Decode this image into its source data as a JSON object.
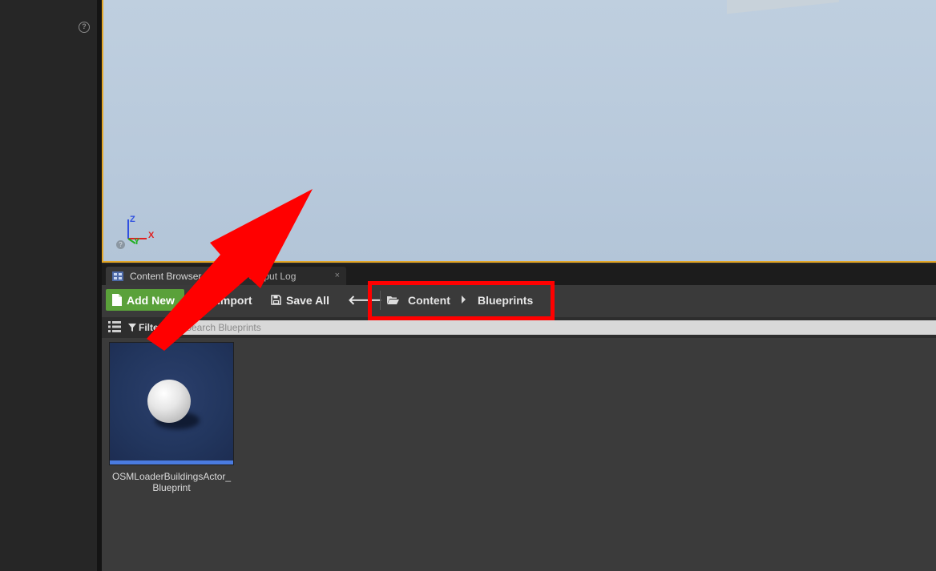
{
  "tabs": {
    "content_browser": "Content Browser",
    "output_log": "Output Log",
    "close_glyph": "×"
  },
  "toolbar": {
    "add_new": "Add New",
    "import": "Import",
    "save_all": "Save All",
    "back_glyph": "🡐"
  },
  "breadcrumb": {
    "root": "Content",
    "current": "Blueprints"
  },
  "filterbar": {
    "filters_label": "Filters",
    "search_placeholder": "Search Blueprints"
  },
  "viewport": {
    "axis_z": "Z",
    "axis_x": "X",
    "axis_y": "Y"
  },
  "assets": [
    {
      "name": "OSMLoaderBuildingsActor_ Blueprint",
      "line1": "OSMLoaderBuildingsActor_",
      "line2": "Blueprint"
    }
  ],
  "colors": {
    "highlight": "#ff0000",
    "add_new_green": "#5aa13a",
    "viewport_border": "#e2a628",
    "asset_type_bar": "#4a7be0"
  }
}
